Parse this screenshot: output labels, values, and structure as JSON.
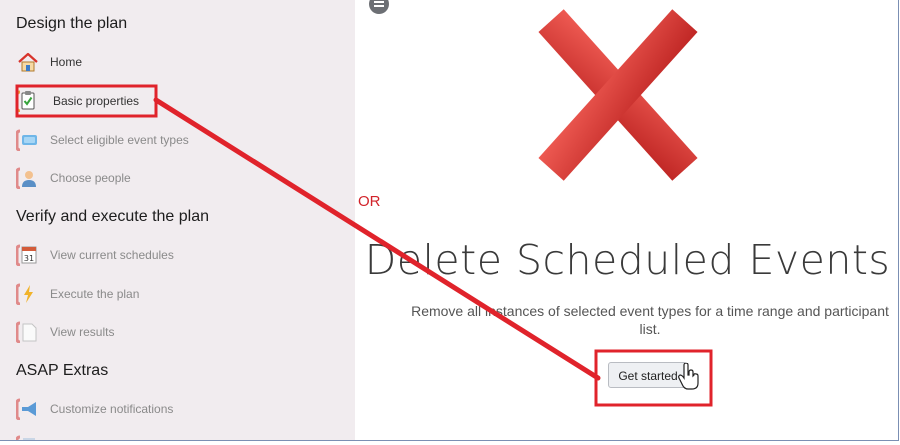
{
  "sidebar": {
    "sections": [
      {
        "title": "Design the plan"
      },
      {
        "title": "Verify and execute the plan"
      },
      {
        "title": "ASAP Extras"
      }
    ],
    "items": [
      {
        "label": "Home",
        "icon": "home-icon"
      },
      {
        "label": "Basic properties",
        "icon": "clipboard-check-icon"
      },
      {
        "label": "Select eligible event types",
        "icon": "event-type-icon"
      },
      {
        "label": "Choose people",
        "icon": "person-icon"
      },
      {
        "label": "View current schedules",
        "icon": "calendar-icon"
      },
      {
        "label": "Execute the plan",
        "icon": "lightning-icon"
      },
      {
        "label": "View results",
        "icon": "document-icon"
      },
      {
        "label": "Customize notifications",
        "icon": "megaphone-icon"
      }
    ]
  },
  "main": {
    "title": "Delete Scheduled Events",
    "description": "Remove all instances of selected event types for a time range and participant list.",
    "button_label": "Get started"
  },
  "annotation": {
    "or_label": "OR",
    "color": "#e0232b"
  },
  "colors": {
    "sidebar_bg": "#f1ecef",
    "x_red": "#d9302c",
    "annotation_red": "#e0232b"
  }
}
